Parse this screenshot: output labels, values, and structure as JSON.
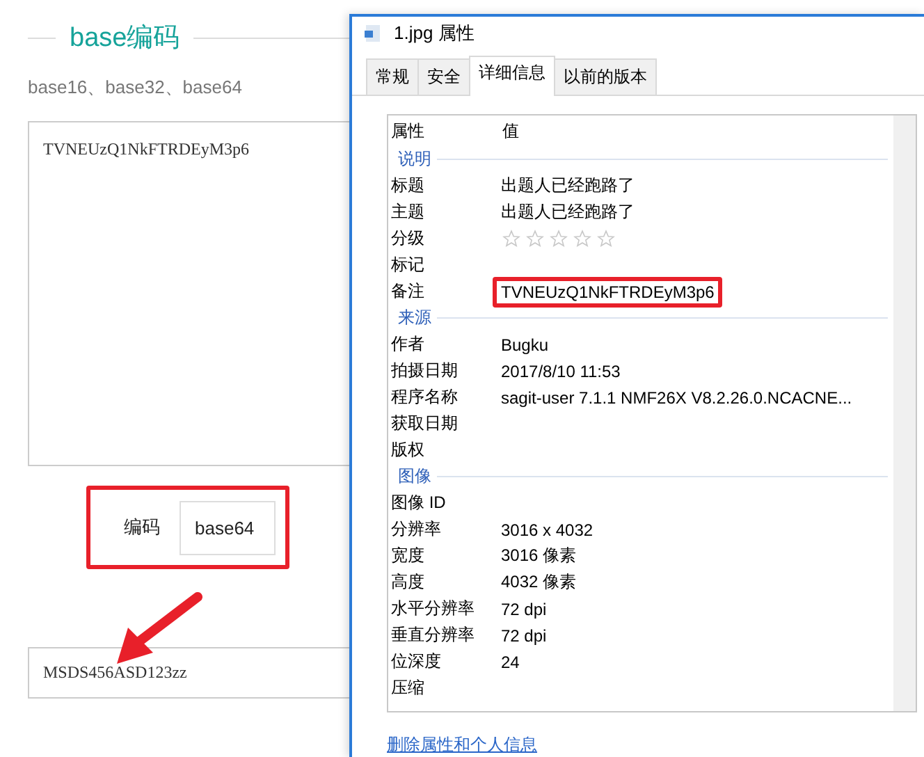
{
  "page": {
    "title": "base编码",
    "subtitle": "base16、base32、base64",
    "input": {
      "value": "TVNEUzQ1NkFTRDEyM3p6"
    },
    "encoding": {
      "label": "编码",
      "value": "base64",
      "highlighted": true
    },
    "output": {
      "value": "MSDS456ASD123zz"
    }
  },
  "dialog": {
    "title": "1.jpg 属性",
    "tabs": [
      {
        "label": "常规",
        "selected": false
      },
      {
        "label": "安全",
        "selected": false
      },
      {
        "label": "详细信息",
        "selected": true
      },
      {
        "label": "以前的版本",
        "selected": false
      }
    ],
    "columns": [
      "属性",
      "值"
    ],
    "rows": [
      {
        "kind": "section",
        "label": "说明"
      },
      {
        "kind": "field",
        "name": "标题",
        "value": "出题人已经跑路了"
      },
      {
        "kind": "field",
        "name": "主题",
        "value": "出题人已经跑路了"
      },
      {
        "kind": "rating",
        "name": "分级",
        "stars": 0
      },
      {
        "kind": "field",
        "name": "标记"
      },
      {
        "kind": "field",
        "name": "备注",
        "value": "TVNEUzQ1NkFTRDEyM3p6",
        "highlighted": true
      },
      {
        "kind": "section",
        "label": "来源"
      },
      {
        "kind": "field",
        "name": "作者",
        "value": "Bugku"
      },
      {
        "kind": "field",
        "name": "拍摄日期",
        "value": "2017/8/10 11:53"
      },
      {
        "kind": "field",
        "name": "程序名称",
        "value": "sagit-user 7.1.1 NMF26X V8.2.26.0.NCACNE..."
      },
      {
        "kind": "field",
        "name": "获取日期"
      },
      {
        "kind": "field",
        "name": "版权"
      },
      {
        "kind": "section",
        "label": "图像"
      },
      {
        "kind": "field",
        "name": "图像 ID"
      },
      {
        "kind": "field",
        "name": "分辨率",
        "value": "3016 x 4032"
      },
      {
        "kind": "field",
        "name": "宽度",
        "value": "3016 像素"
      },
      {
        "kind": "field",
        "name": "高度",
        "value": "4032 像素"
      },
      {
        "kind": "field",
        "name": "水平分辨率",
        "value": "72 dpi"
      },
      {
        "kind": "field",
        "name": "垂直分辨率",
        "value": "72 dpi"
      },
      {
        "kind": "field",
        "name": "位深度",
        "value": "24"
      },
      {
        "kind": "field",
        "name": "压缩"
      }
    ],
    "link": "删除属性和个人信息"
  }
}
